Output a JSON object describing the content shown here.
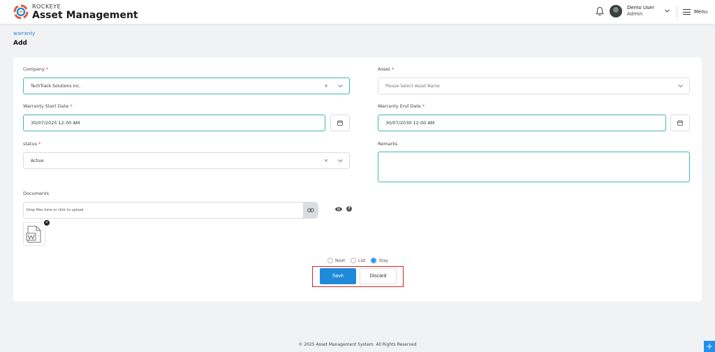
{
  "header": {
    "brand_top": "ROCKEYE",
    "brand_main": "Asset Management",
    "user_name": "Demo User",
    "user_role": "Admin",
    "menu_label": "Menu",
    "icons": [
      "logo-icon",
      "bell-icon",
      "chevron-down-icon",
      "hamburger-icon"
    ]
  },
  "page": {
    "breadcrumb": "warranty",
    "title": "Add"
  },
  "form": {
    "company": {
      "label": "Company",
      "value": "TechTrack Solutions Inc."
    },
    "asset": {
      "label": "Asset",
      "placeholder": "Please Select Asset Name"
    },
    "warranty_start": {
      "label": "Warranty Start Date",
      "value": "30/07/2025 12:00 AM"
    },
    "warranty_end": {
      "label": "Warranty End Date",
      "value": "30/07/2030 12:00 AM"
    },
    "status": {
      "label": "status",
      "value": "Active"
    },
    "remarks": {
      "label": "Remarks",
      "value": ""
    },
    "documents": {
      "label": "Documents",
      "dropzone_text": "Drop files here or click to upload"
    },
    "required_marker": "*",
    "clear_glyph": "×",
    "remove_glyph": "×",
    "help_glyph": "?"
  },
  "after_save": {
    "options": [
      "Next",
      "List",
      "Stay"
    ],
    "selected": "Stay"
  },
  "actions": {
    "save_label": "Save",
    "discard_label": "Discard"
  },
  "footer": {
    "text": "© 2025 Asset Management System. All Rights Reserved",
    "fab_glyph": "+"
  },
  "colors": {
    "accent": "#1f8bd8",
    "active_border": "#42b8a6",
    "highlight_box": "#e02020"
  }
}
